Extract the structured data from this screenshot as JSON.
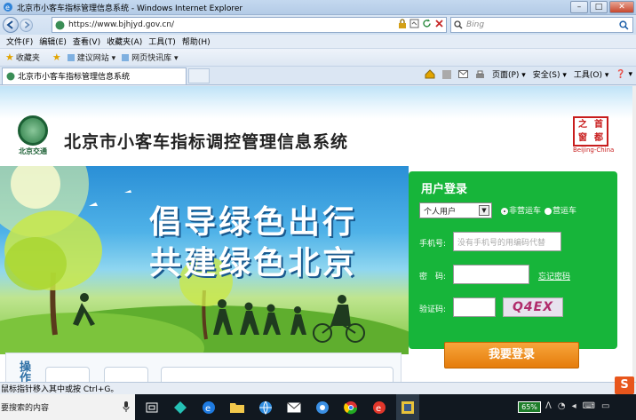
{
  "window": {
    "title": "北京市小客车指标管理信息系统 - Windows Internet Explorer"
  },
  "address": {
    "url": "https://www.bjhjyd.gov.cn/",
    "search_placeholder": "Bing"
  },
  "menu": [
    "文件(F)",
    "编辑(E)",
    "查看(V)",
    "收藏夹(A)",
    "工具(T)",
    "帮助(H)"
  ],
  "favorites": {
    "label": "收藏夹",
    "suggested": "建议网站 ▾",
    "slices": "网页快讯库 ▾"
  },
  "tab": {
    "label": "北京市小客车指标管理信息系统"
  },
  "command_bar": {
    "page": "页面(P) ▾",
    "safety": "安全(S) ▾",
    "tools": "工具(O) ▾",
    "help": "❓ ▾"
  },
  "site": {
    "logo_text": "北京交通",
    "title": "北京市小客车指标调控管理信息系统",
    "seal": {
      "c1": "首",
      "c2": "之",
      "c3": "都",
      "c4": "窗",
      "caption": "Beijing-China"
    }
  },
  "banner": {
    "slogan_line1": "倡导绿色出行",
    "slogan_line2": "共建绿色北京"
  },
  "login": {
    "title": "用户登录",
    "user_type_value": "个人用户",
    "radio_non_commercial": "非营运车",
    "radio_commercial": "营运车",
    "phone_label": "手机号:",
    "phone_placeholder": "没有手机号的用编码代替",
    "password_label": "密　码:",
    "forgot_link": "忘记密码",
    "captcha_label": "验证码:",
    "captcha_text": "Q4EX",
    "submit": "我要登录"
  },
  "operations": {
    "title": "操作"
  },
  "statusbar": {
    "text": "鼠标指针移入其中或按 Ctrl+G。"
  },
  "taskbar": {
    "search_placeholder": "要搜索的内容",
    "battery": "65%"
  },
  "sogou": {
    "label": "S"
  },
  "colors": {
    "panel_green": "#17b53a",
    "login_orange": "#ee8f1f",
    "seal_red": "#c81d1d"
  }
}
